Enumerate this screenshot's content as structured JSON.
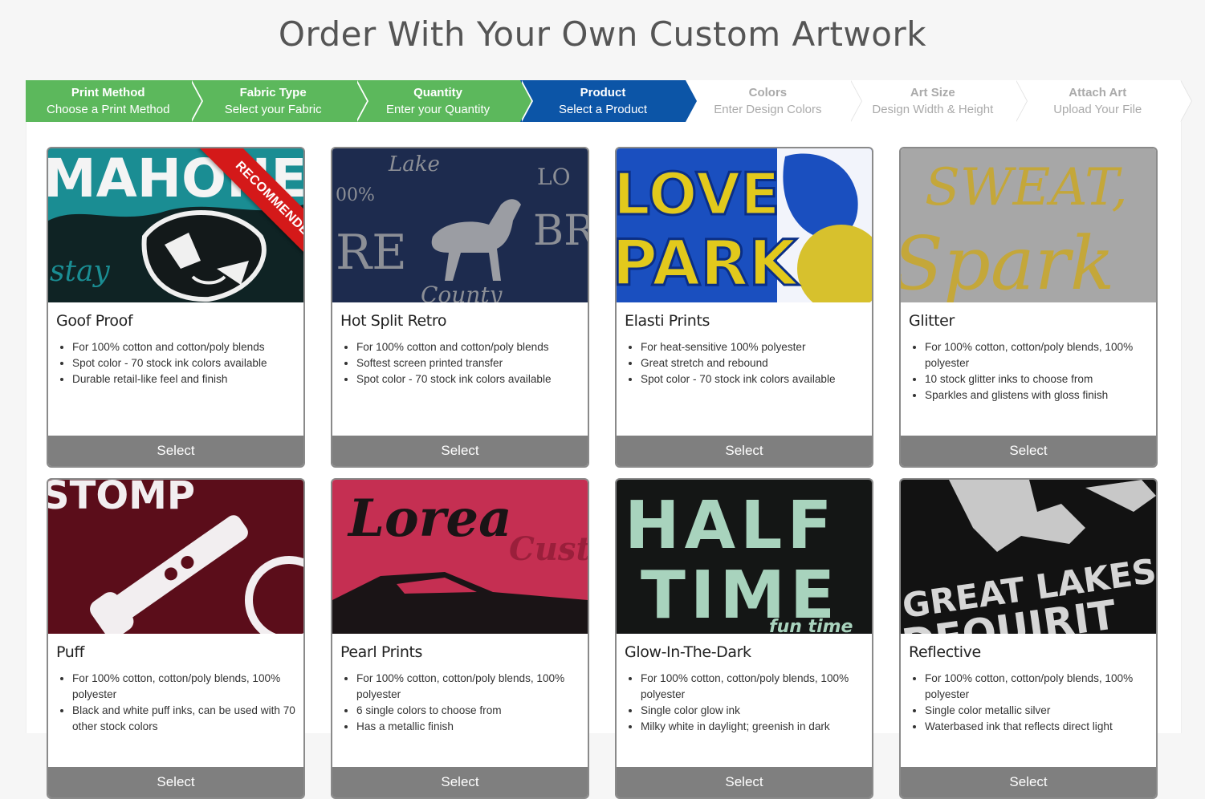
{
  "page": {
    "title": "Order With Your Own Custom Artwork"
  },
  "steps": [
    {
      "title": "Print Method",
      "subtitle": "Choose a Print Method",
      "state": "done"
    },
    {
      "title": "Fabric Type",
      "subtitle": "Select your Fabric",
      "state": "done"
    },
    {
      "title": "Quantity",
      "subtitle": "Enter your Quantity",
      "state": "done"
    },
    {
      "title": "Product",
      "subtitle": "Select a Product",
      "state": "active"
    },
    {
      "title": "Colors",
      "subtitle": "Enter Design Colors",
      "state": "todo"
    },
    {
      "title": "Art Size",
      "subtitle": "Design Width & Height",
      "state": "todo"
    },
    {
      "title": "Attach Art",
      "subtitle": "Upload Your File",
      "state": "todo"
    }
  ],
  "colors": {
    "done": "#5cb85c",
    "active": "#0c55a7",
    "select_button": "#7f7f7f",
    "ribbon": "#d41919"
  },
  "products": [
    {
      "name": "Goof Proof",
      "badge": "RECOMMENDED",
      "features": [
        "For 100% cotton and cotton/poly blends",
        "Spot color - 70 stock ink colors available",
        "Durable retail-like feel and finish"
      ],
      "select_label": "Select"
    },
    {
      "name": "Hot Split Retro",
      "features": [
        "For 100% cotton and cotton/poly blends",
        "Softest screen printed transfer",
        "Spot color - 70 stock ink colors available"
      ],
      "select_label": "Select"
    },
    {
      "name": "Elasti Prints",
      "features": [
        "For heat-sensitive 100% polyester",
        "Great stretch and rebound",
        "Spot color - 70 stock ink colors available"
      ],
      "select_label": "Select"
    },
    {
      "name": "Glitter",
      "features": [
        "For 100% cotton, cotton/poly blends, 100% polyester",
        "10 stock glitter inks to choose from",
        "Sparkles and glistens with gloss finish"
      ],
      "select_label": "Select"
    },
    {
      "name": "Puff",
      "features": [
        "For 100% cotton, cotton/poly blends, 100% polyester",
        "Black and white puff inks, can be used with 70 other stock colors"
      ],
      "select_label": "Select"
    },
    {
      "name": "Pearl Prints",
      "features": [
        "For 100% cotton, cotton/poly blends, 100% polyester",
        "6 single colors to choose from",
        "Has a metallic finish"
      ],
      "select_label": "Select"
    },
    {
      "name": "Glow-In-The-Dark",
      "features": [
        "For 100% cotton, cotton/poly blends, 100% polyester",
        "Single color glow ink",
        "Milky white in daylight; greenish in dark"
      ],
      "select_label": "Select"
    },
    {
      "name": "Reflective",
      "features": [
        "For 100% cotton, cotton/poly blends, 100% polyester",
        "Single color metallic silver",
        "Waterbased ink that reflects direct light"
      ],
      "select_label": "Select"
    }
  ],
  "images": {
    "goof_proof": {
      "icon": "panther-print-image",
      "text": "MAHONE",
      "script": "stay"
    },
    "hot_split_retro": {
      "icon": "horse-print-image",
      "words": [
        "Lake",
        "LO",
        "00%",
        "RE",
        "BR",
        "County"
      ]
    },
    "elasti_prints": {
      "icon": "love-park-print-image",
      "words": [
        "LOVE",
        "PARK"
      ]
    },
    "glitter": {
      "icon": "glitter-print-image",
      "words": [
        "SWEAT,",
        "Spark"
      ]
    },
    "puff": {
      "icon": "puff-print-image",
      "words": [
        "STOMP"
      ]
    },
    "pearl_prints": {
      "icon": "car-print-image",
      "words": [
        "Lorea",
        "Cust"
      ]
    },
    "glow": {
      "icon": "halftime-print-image",
      "words": [
        "HALF",
        "TIME",
        "fun time"
      ]
    },
    "reflective": {
      "icon": "great-lakes-print-image",
      "words": [
        "GREAT LAKES",
        "DEQUIRIT"
      ]
    }
  }
}
